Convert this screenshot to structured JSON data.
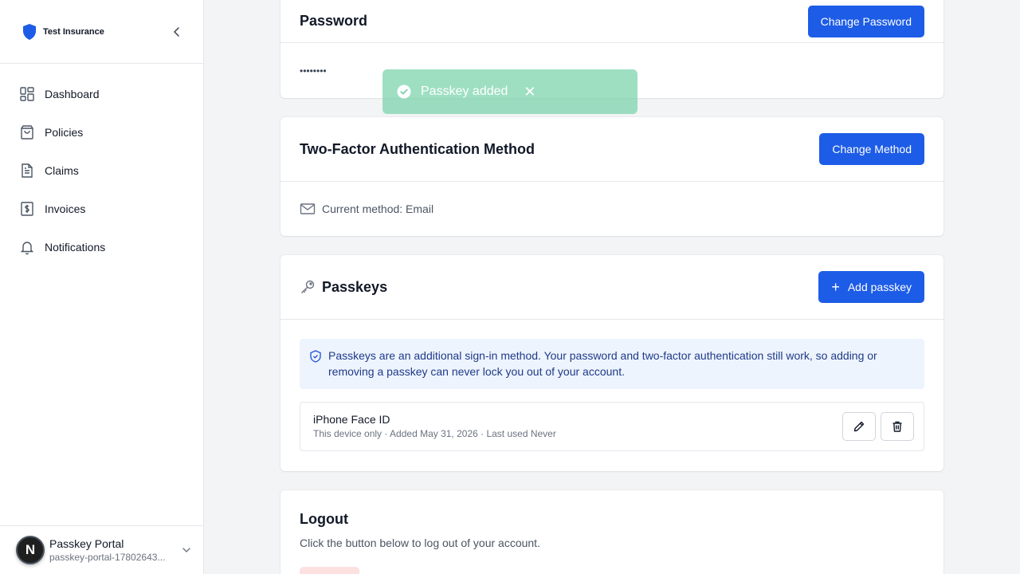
{
  "brand": {
    "name": "Test Insurance"
  },
  "nav": [
    {
      "label": "Dashboard"
    },
    {
      "label": "Policies"
    },
    {
      "label": "Claims"
    },
    {
      "label": "Invoices"
    },
    {
      "label": "Notifications"
    }
  ],
  "org": {
    "avatar_letter": "N",
    "name": "Passkey Portal",
    "sub": "passkey-portal-17802643..."
  },
  "password": {
    "title": "Password",
    "button": "Change Password",
    "value": "••••••••"
  },
  "twofa": {
    "title": "Two-Factor Authentication Method",
    "button": "Change Method",
    "current": "Current method: Email"
  },
  "passkeys": {
    "title": "Passkeys",
    "add_button": "Add passkey",
    "info": "Passkeys are an additional sign-in method. Your password and two-factor authentication still work, so adding or removing a passkey can never lock you out of your account.",
    "items": [
      {
        "name": "iPhone Face ID",
        "meta": "This device only · Added May 31, 2026 · Last used Never"
      }
    ]
  },
  "logout": {
    "title": "Logout",
    "description": "Click the button below to log out of your account."
  },
  "toast": {
    "message": "Passkey added",
    "close": "✕"
  },
  "colors": {
    "primary": "#1d5ce6",
    "toast": "#78d2aa",
    "info_bg": "#eef4fd"
  }
}
